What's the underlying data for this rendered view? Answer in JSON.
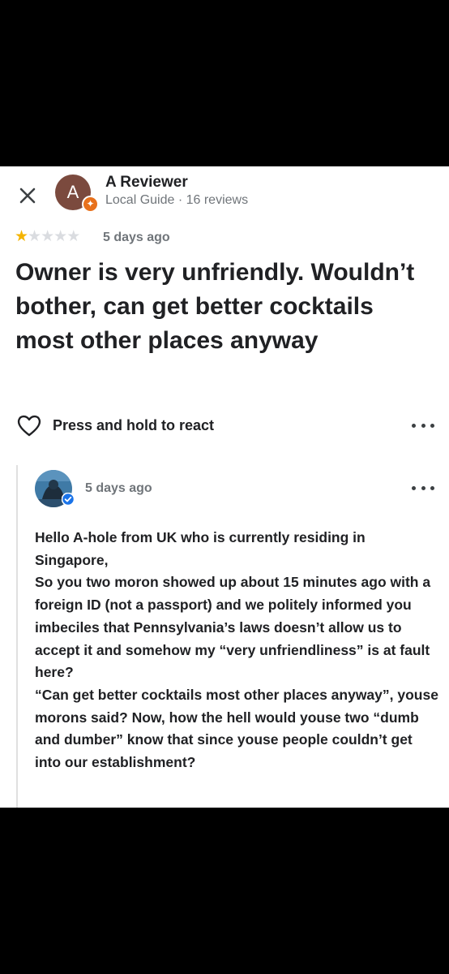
{
  "reviewer": {
    "avatar_letter": "A",
    "name": "A Reviewer",
    "meta": "Local Guide · 16 reviews"
  },
  "review": {
    "rating": 1,
    "max_rating": 5,
    "date": "5 days ago",
    "text": "Owner is very unfriendly. Wouldn’t bother, can get better cocktails most other places anyway"
  },
  "react": {
    "label": "Press and hold to react"
  },
  "reply": {
    "date": "5 days ago",
    "text": "Hello A-hole from UK who is currently residing in Singapore,\nSo you two moron showed up about 15 minutes ago with a foreign ID (not a passport) and we politely informed you imbeciles that Pennsylvania’s laws doesn’t allow us to accept it and somehow my “very unfriendliness” is at fault here?\n“Can get better cocktails most other places anyway”, youse morons said? Now, how the hell would youse two “dumb and dumber” know that since youse people couldn’t get into our establishment?"
  },
  "icons": {
    "close": "close-icon",
    "heart": "heart-outline-icon",
    "more": "more-horizontal-icon",
    "verified": "verified-badge-icon",
    "local_guide": "local-guide-badge-icon"
  },
  "colors": {
    "star_filled": "#f4b400",
    "star_empty": "#dadce0",
    "guide_badge": "#e8711c",
    "verified": "#1a73e8",
    "avatar_bg": "#7b4a3e"
  }
}
